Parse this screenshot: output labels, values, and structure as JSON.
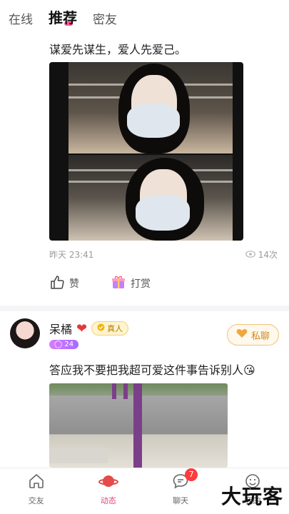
{
  "topbar": {
    "tabs": [
      {
        "label": "在线"
      },
      {
        "label": "推荐"
      },
      {
        "label": "密友"
      }
    ]
  },
  "post1": {
    "text": "谋爱先谋生，爱人先爱己。",
    "time": "昨天 23:41",
    "views": "14次",
    "like_label": "赞",
    "reward_label": "打赏"
  },
  "post2": {
    "username": "呆橘",
    "verified_label": "真人",
    "count_badge": "24",
    "chat_button": "私聊",
    "text": "答应我不要把我超可爱这件事告诉别人😘"
  },
  "bottom_nav": {
    "items": [
      {
        "label": "交友"
      },
      {
        "label": "动态"
      },
      {
        "label": "聊天",
        "badge": "7"
      },
      {
        "label": "我的"
      }
    ]
  },
  "watermark": "大玩客",
  "colors": {
    "accent": "#e0457b",
    "badge_red": "#ff3b3b",
    "chat_button": "#d18a1d"
  }
}
